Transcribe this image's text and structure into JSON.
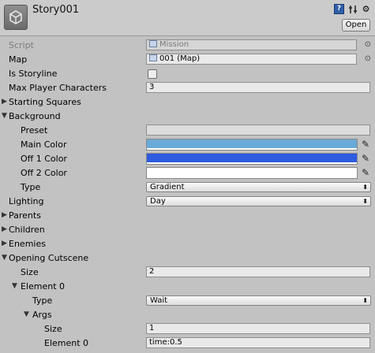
{
  "header": {
    "title": "Story001",
    "open_button": "Open",
    "icons": [
      "unity-logo-icon",
      "help-icon",
      "preset-icon",
      "gear-icon"
    ]
  },
  "fields": {
    "script": {
      "label": "Script",
      "value": "Mission"
    },
    "map": {
      "label": "Map",
      "value": "001 (Map)"
    },
    "is_storyline": {
      "label": "Is Storyline",
      "checked": false
    },
    "max_player_characters": {
      "label": "Max Player Characters",
      "value": "3"
    },
    "starting_squares": {
      "label": "Starting Squares"
    },
    "background": {
      "label": "Background",
      "preset": {
        "label": "Preset",
        "value": ""
      },
      "main_color": {
        "label": "Main Color",
        "color": "#6aaad8"
      },
      "off1_color": {
        "label": "Off 1 Color",
        "color": "#2e5be0"
      },
      "off2_color": {
        "label": "Off 2 Color",
        "color": "#ffffff"
      },
      "type": {
        "label": "Type",
        "value": "Gradient"
      }
    },
    "lighting": {
      "label": "Lighting",
      "value": "Day"
    },
    "parents": {
      "label": "Parents"
    },
    "children": {
      "label": "Children"
    },
    "enemies": {
      "label": "Enemies"
    },
    "opening_cutscene": {
      "label": "Opening Cutscene",
      "size": {
        "label": "Size",
        "value": "2"
      },
      "element0": {
        "label": "Element 0",
        "type": {
          "label": "Type",
          "value": "Wait"
        },
        "args": {
          "label": "Args",
          "size": {
            "label": "Size",
            "value": "1"
          },
          "element0": {
            "label": "Element 0",
            "value": "time:0.5"
          }
        }
      }
    }
  }
}
